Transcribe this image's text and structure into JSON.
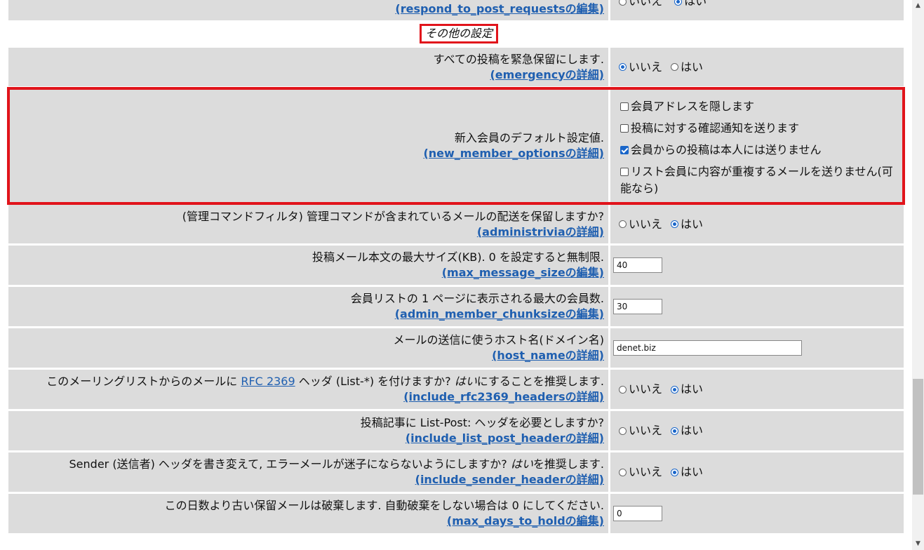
{
  "top_row": {
    "link": "(respond_to_post_requestsの編集)",
    "opt_no": "いいえ",
    "opt_yes": "はい"
  },
  "section": {
    "title": "その他の設定"
  },
  "rows": [
    {
      "label": "すべての投稿を緊急保留にします.",
      "link": "(emergencyの詳細)",
      "opt_no": "いいえ",
      "opt_yes": "はい",
      "selected": "いいえ"
    },
    {
      "label": "新入会員のデフォルト設定値.",
      "link": "(new_member_optionsの詳細)",
      "checkboxes": [
        {
          "label": "会員アドレスを隠します",
          "checked": false
        },
        {
          "label": "投稿に対する確認通知を送ります",
          "checked": false
        },
        {
          "label": "会員からの投稿は本人には送りません",
          "checked": true
        },
        {
          "label": "リスト会員に内容が重複するメールを送りません(可",
          "label2": "能なら)",
          "checked": false
        }
      ]
    },
    {
      "label": "(管理コマンドフィルタ) 管理コマンドが含まれているメールの配送を保留しますか?",
      "link": "(administriviaの詳細)",
      "opt_no": "いいえ",
      "opt_yes": "はい",
      "selected": "はい"
    },
    {
      "label": "投稿メール本文の最大サイズ(KB). 0 を設定すると無制限.",
      "link": "(max_message_sizeの編集)",
      "value": "40"
    },
    {
      "label": "会員リストの 1 ページに表示される最大の会員数.",
      "link": "(admin_member_chunksizeの編集)",
      "value": "30"
    },
    {
      "label": "メールの送信に使うホスト名(ドメイン名)",
      "link": "(host_nameの詳細)",
      "value": "denet.biz"
    },
    {
      "label_pre": "このメーリングリストからのメールに ",
      "label_link": "RFC 2369",
      "label_post": " ヘッダ (List-*) を付けますか? ",
      "label_em": "はい",
      "label_tail": "にすることを推奨します.",
      "link": "(include_rfc2369_headersの詳細)",
      "opt_no": "いいえ",
      "opt_yes": "はい",
      "selected": "はい"
    },
    {
      "label": "投稿記事に List-Post: ヘッダを必要としますか?",
      "link": "(include_list_post_headerの詳細)",
      "opt_no": "いいえ",
      "opt_yes": "はい",
      "selected": "はい"
    },
    {
      "label_pre": "Sender (送信者) ヘッダを書き変えて, エラーメールが迷子にならないようにしますか? ",
      "label_em": "はい",
      "label_tail": "を推奨します.",
      "link": "(include_sender_headerの詳細)",
      "opt_no": "いいえ",
      "opt_yes": "はい",
      "selected": "はい"
    },
    {
      "label": "この日数より古い保留メールは破棄します. 自動破棄をしない場合は 0 にしてください.",
      "link": "(max_days_to_holdの編集)",
      "value": "0"
    }
  ],
  "colors": {
    "highlight": "#e1141b",
    "link": "#1f5fb0",
    "cell_bg": "#dcdcdc",
    "accent": "#1a66c9"
  }
}
